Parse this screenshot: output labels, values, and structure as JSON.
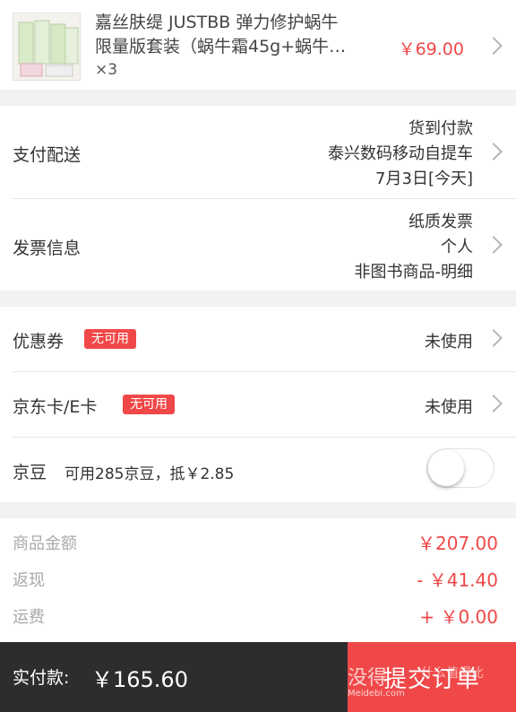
{
  "product": {
    "name_line1": "嘉丝肤缇 JUSTBB 弹力修护蜗牛",
    "name_line2": "限量版套装（蜗牛霜45g+蜗牛…",
    "quantity": "×3",
    "price": "￥69.00"
  },
  "payment": {
    "label": "支付配送",
    "method": "货到付款",
    "pickup": "泰兴数码移动自提车",
    "date": "7月3日[今天]"
  },
  "invoice": {
    "label": "发票信息",
    "type": "纸质发票",
    "title": "个人",
    "content": "非图书商品-明细"
  },
  "coupon": {
    "label": "优惠券",
    "badge": "无可用",
    "status": "未使用"
  },
  "jdcard": {
    "label": "京东卡/E卡",
    "badge": "无可用",
    "status": "未使用"
  },
  "jingdou": {
    "label": "京豆",
    "desc": "可用285京豆，抵￥2.85",
    "enabled": false
  },
  "summary": {
    "goods_label": "商品金额",
    "goods_value": "￥207.00",
    "cashback_label": "返现",
    "cashback_value": "- ￥41.40",
    "shipping_label": "运费",
    "shipping_value": "+ ￥0.00"
  },
  "bottom": {
    "pay_label": "实付款:",
    "pay_amount": "￥165.60",
    "submit_label": "提交订单",
    "watermark": "没得",
    "watermark_url": "Meidebi.com",
    "watermark_right": "什么值得比"
  },
  "colors": {
    "accent": "#f04848",
    "bar": "#2d2d2d"
  }
}
